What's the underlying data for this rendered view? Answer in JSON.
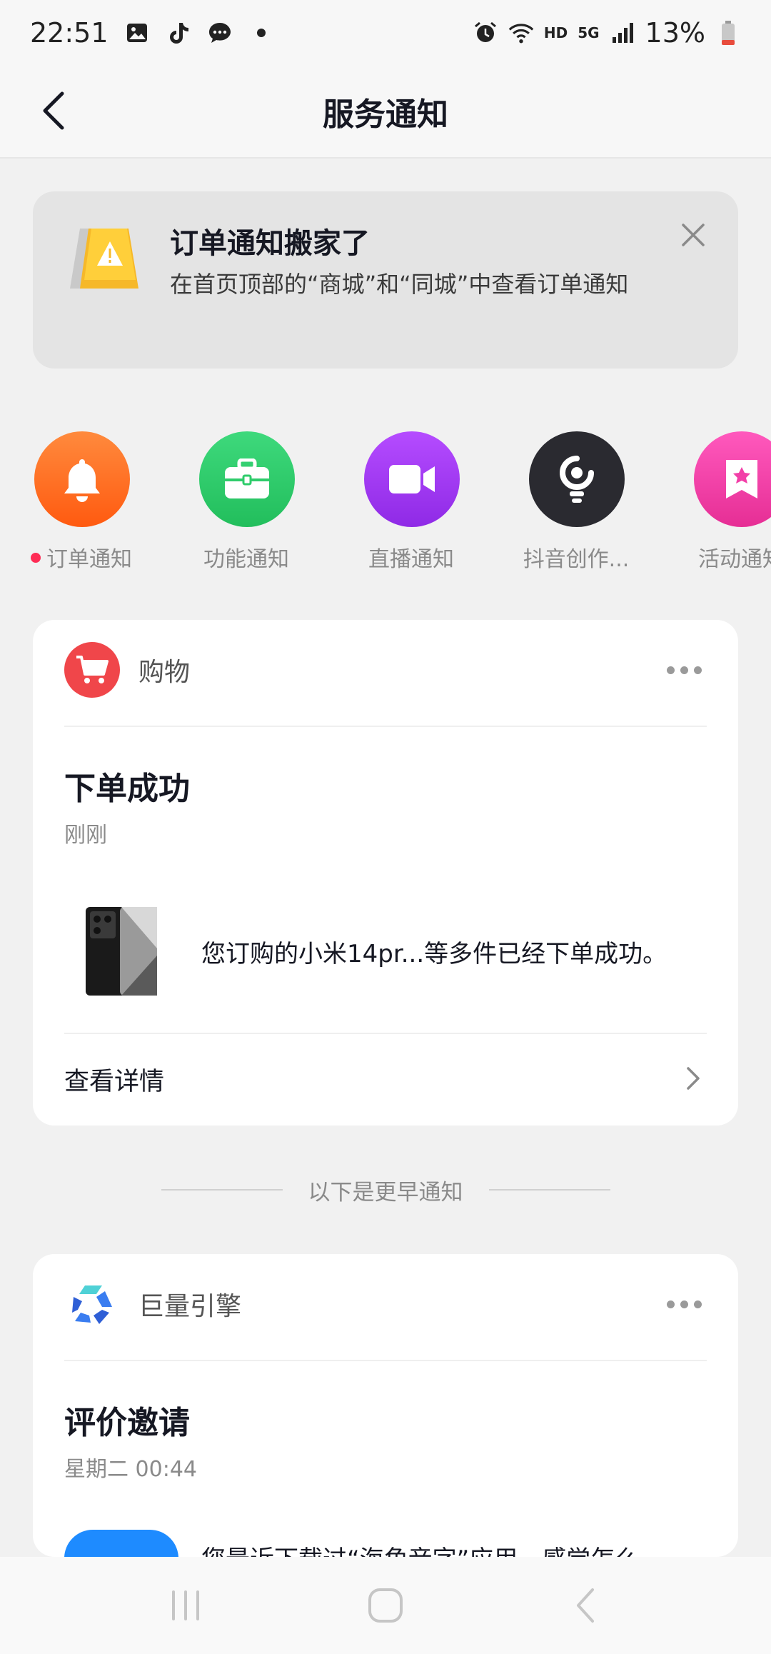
{
  "status_bar": {
    "time": "22:51",
    "battery": "13%",
    "network": "5G",
    "hd": "HD",
    "icons": [
      "gallery-icon",
      "tiktok-icon",
      "chat-icon",
      "dot-icon",
      "alarm-icon",
      "wifi-icon",
      "signal-icon",
      "battery-icon"
    ]
  },
  "header": {
    "title": "服务通知",
    "back_icon": "chevron-left-icon"
  },
  "banner": {
    "title": "订单通知搬家了",
    "text": "在首页顶部的“商城”和“同城”中查看订单通知",
    "icon": "warning-sign-icon",
    "close_icon": "close-icon"
  },
  "categories": [
    {
      "label": "订单通知",
      "icon": "bell-icon",
      "color": "#ff6a1f",
      "has_dot": true
    },
    {
      "label": "功能通知",
      "icon": "briefcase-icon",
      "color": "#2fcc6b",
      "has_dot": false
    },
    {
      "label": "直播通知",
      "icon": "video-camera-icon",
      "color": "#a33cf2",
      "has_dot": false
    },
    {
      "label": "抖音创作...",
      "icon": "bulb-icon",
      "color": "#2a2a30",
      "has_dot": false
    },
    {
      "label": "活动通知",
      "icon": "bookmark-star-icon",
      "color": "#f23fa8",
      "has_dot": false
    }
  ],
  "card_shopping": {
    "source": "购物",
    "source_icon": "cart-icon",
    "source_color": "#f0464a",
    "title": "下单成功",
    "time": "刚刚",
    "body": "您订购的小米14pr...等多件已经下单成功。",
    "link": "查看详情"
  },
  "separator_text": "以下是更早通知",
  "card_engine": {
    "source": "巨量引擎",
    "source_icon": "engine-logo-icon",
    "title": "评价邀请",
    "time": "星期二 00:44",
    "body_partial": "您最近下载过“海角音字”应用，感觉怎么"
  },
  "nav_bar": {
    "recent_icon": "recent-apps-icon",
    "home_icon": "home-icon",
    "back_icon": "back-icon"
  }
}
